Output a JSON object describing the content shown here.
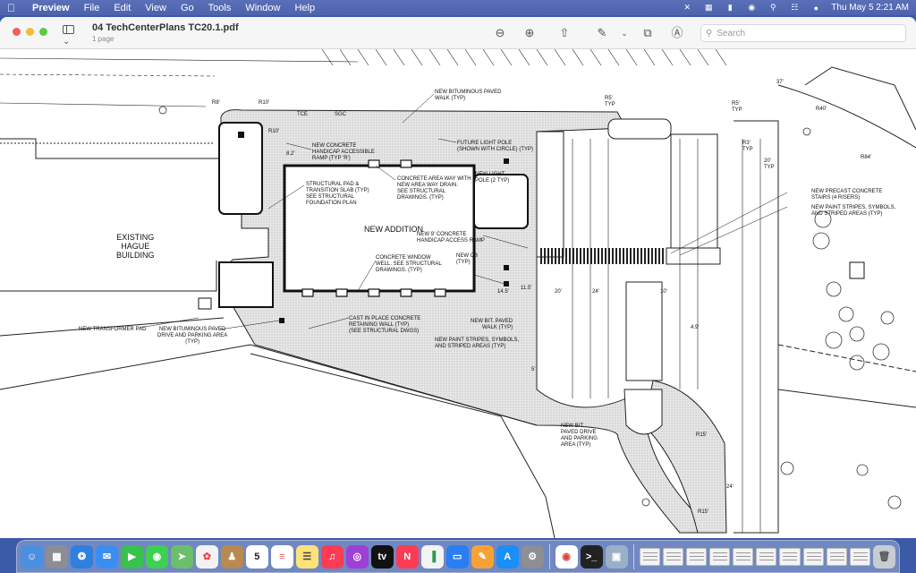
{
  "menubar": {
    "app": "Preview",
    "items": [
      "File",
      "Edit",
      "View",
      "Go",
      "Tools",
      "Window",
      "Help"
    ],
    "clock": "Thu May 5  2:21 AM"
  },
  "window": {
    "title": "04 TechCenterPlans TC20.1.pdf",
    "subtitle": "1 page",
    "search_placeholder": "Search"
  },
  "drawing": {
    "existing_building": "EXISTING\nHAGUE\nBUILDING",
    "new_addition": "NEW ADDITION",
    "callouts": {
      "bit_walk": "NEW BITUMINOUS PAVED\nWALK (TYP)",
      "ramp": "NEW CONCRETE\nHANDICAP ACCESSIBLE\nRAMP (TYP 'R')",
      "light_pole_future": "FUTURE LIGHT POLE\n(SHOWN WITH CIRCLE) (TYP)",
      "area_way": "CONCRETE AREA WAY WITH\nNEW AREA WAY DRAIN.\nSEE STRUCTURAL\nDRAWINGS. (TYP)",
      "new_light_pole": "NEW LIGHT\nPOLE (2 TYP)",
      "structural_pad": "STRUCTURAL PAD &\nTRANSITION SLAB (TYP)\nSEE STRUCTURAL\nFOUNDATION PLAN",
      "ramp_9": "NEW 9' CONCRETE\nHANDICAP ACCESS RAMP",
      "window_well": "CONCRETE WINDOW\nWELL. SEE STRUCTURAL\nDRAWINGS. (TYP)",
      "new_cb": "NEW CB\n(TYP)",
      "retaining_wall": "CAST IN PLACE CONCRETE\nRETAINING WALL (TYP)\n(SEE STRUCTURAL DWGS)",
      "transformer": "NEW TRANSFORMER PAD",
      "bit_drive": "NEW BITUMINOUS PAVED\nDRIVE AND PARKING AREA\n(TYP)",
      "bit_walk2": "NEW BIT. PAVED\nWALK (TYP)",
      "stripes": "NEW PAINT STRIPES, SYMBOLS,\nAND STRIPED AREAS (TYP)",
      "bit_drive2": "NEW BIT.\nPAVED DRIVE\nAND PARKING\nAREA (TYP)",
      "precast_stairs": "NEW PRECAST CONCRETE\nSTAIRS (4 RISERS)",
      "stripes2": "NEW PAINT STRIPES, SYMBOLS,\nAND STRIPED AREAS (TYP)"
    },
    "tags": {
      "r8": "R8'",
      "r10": "R10'",
      "r10b": "R10'",
      "tce": "TCE",
      "sgc": "SGC",
      "r5typ": "R5'\nTYP",
      "r5typ2": "R5'\nTYP",
      "r40": "R40'",
      "r84": "R84'",
      "r3typ": "R3'\nTYP",
      "d20typ": "20'\nTYP",
      "d37": "37'",
      "d82": "8.2'",
      "d145": "14.5'",
      "d115": "11.5'",
      "d20": "20'",
      "d24": "24'",
      "d10": "10'",
      "d49": "4.9'",
      "d5": "5'",
      "r15": "R15'",
      "r15b": "R15'",
      "d24b": "24'"
    }
  }
}
